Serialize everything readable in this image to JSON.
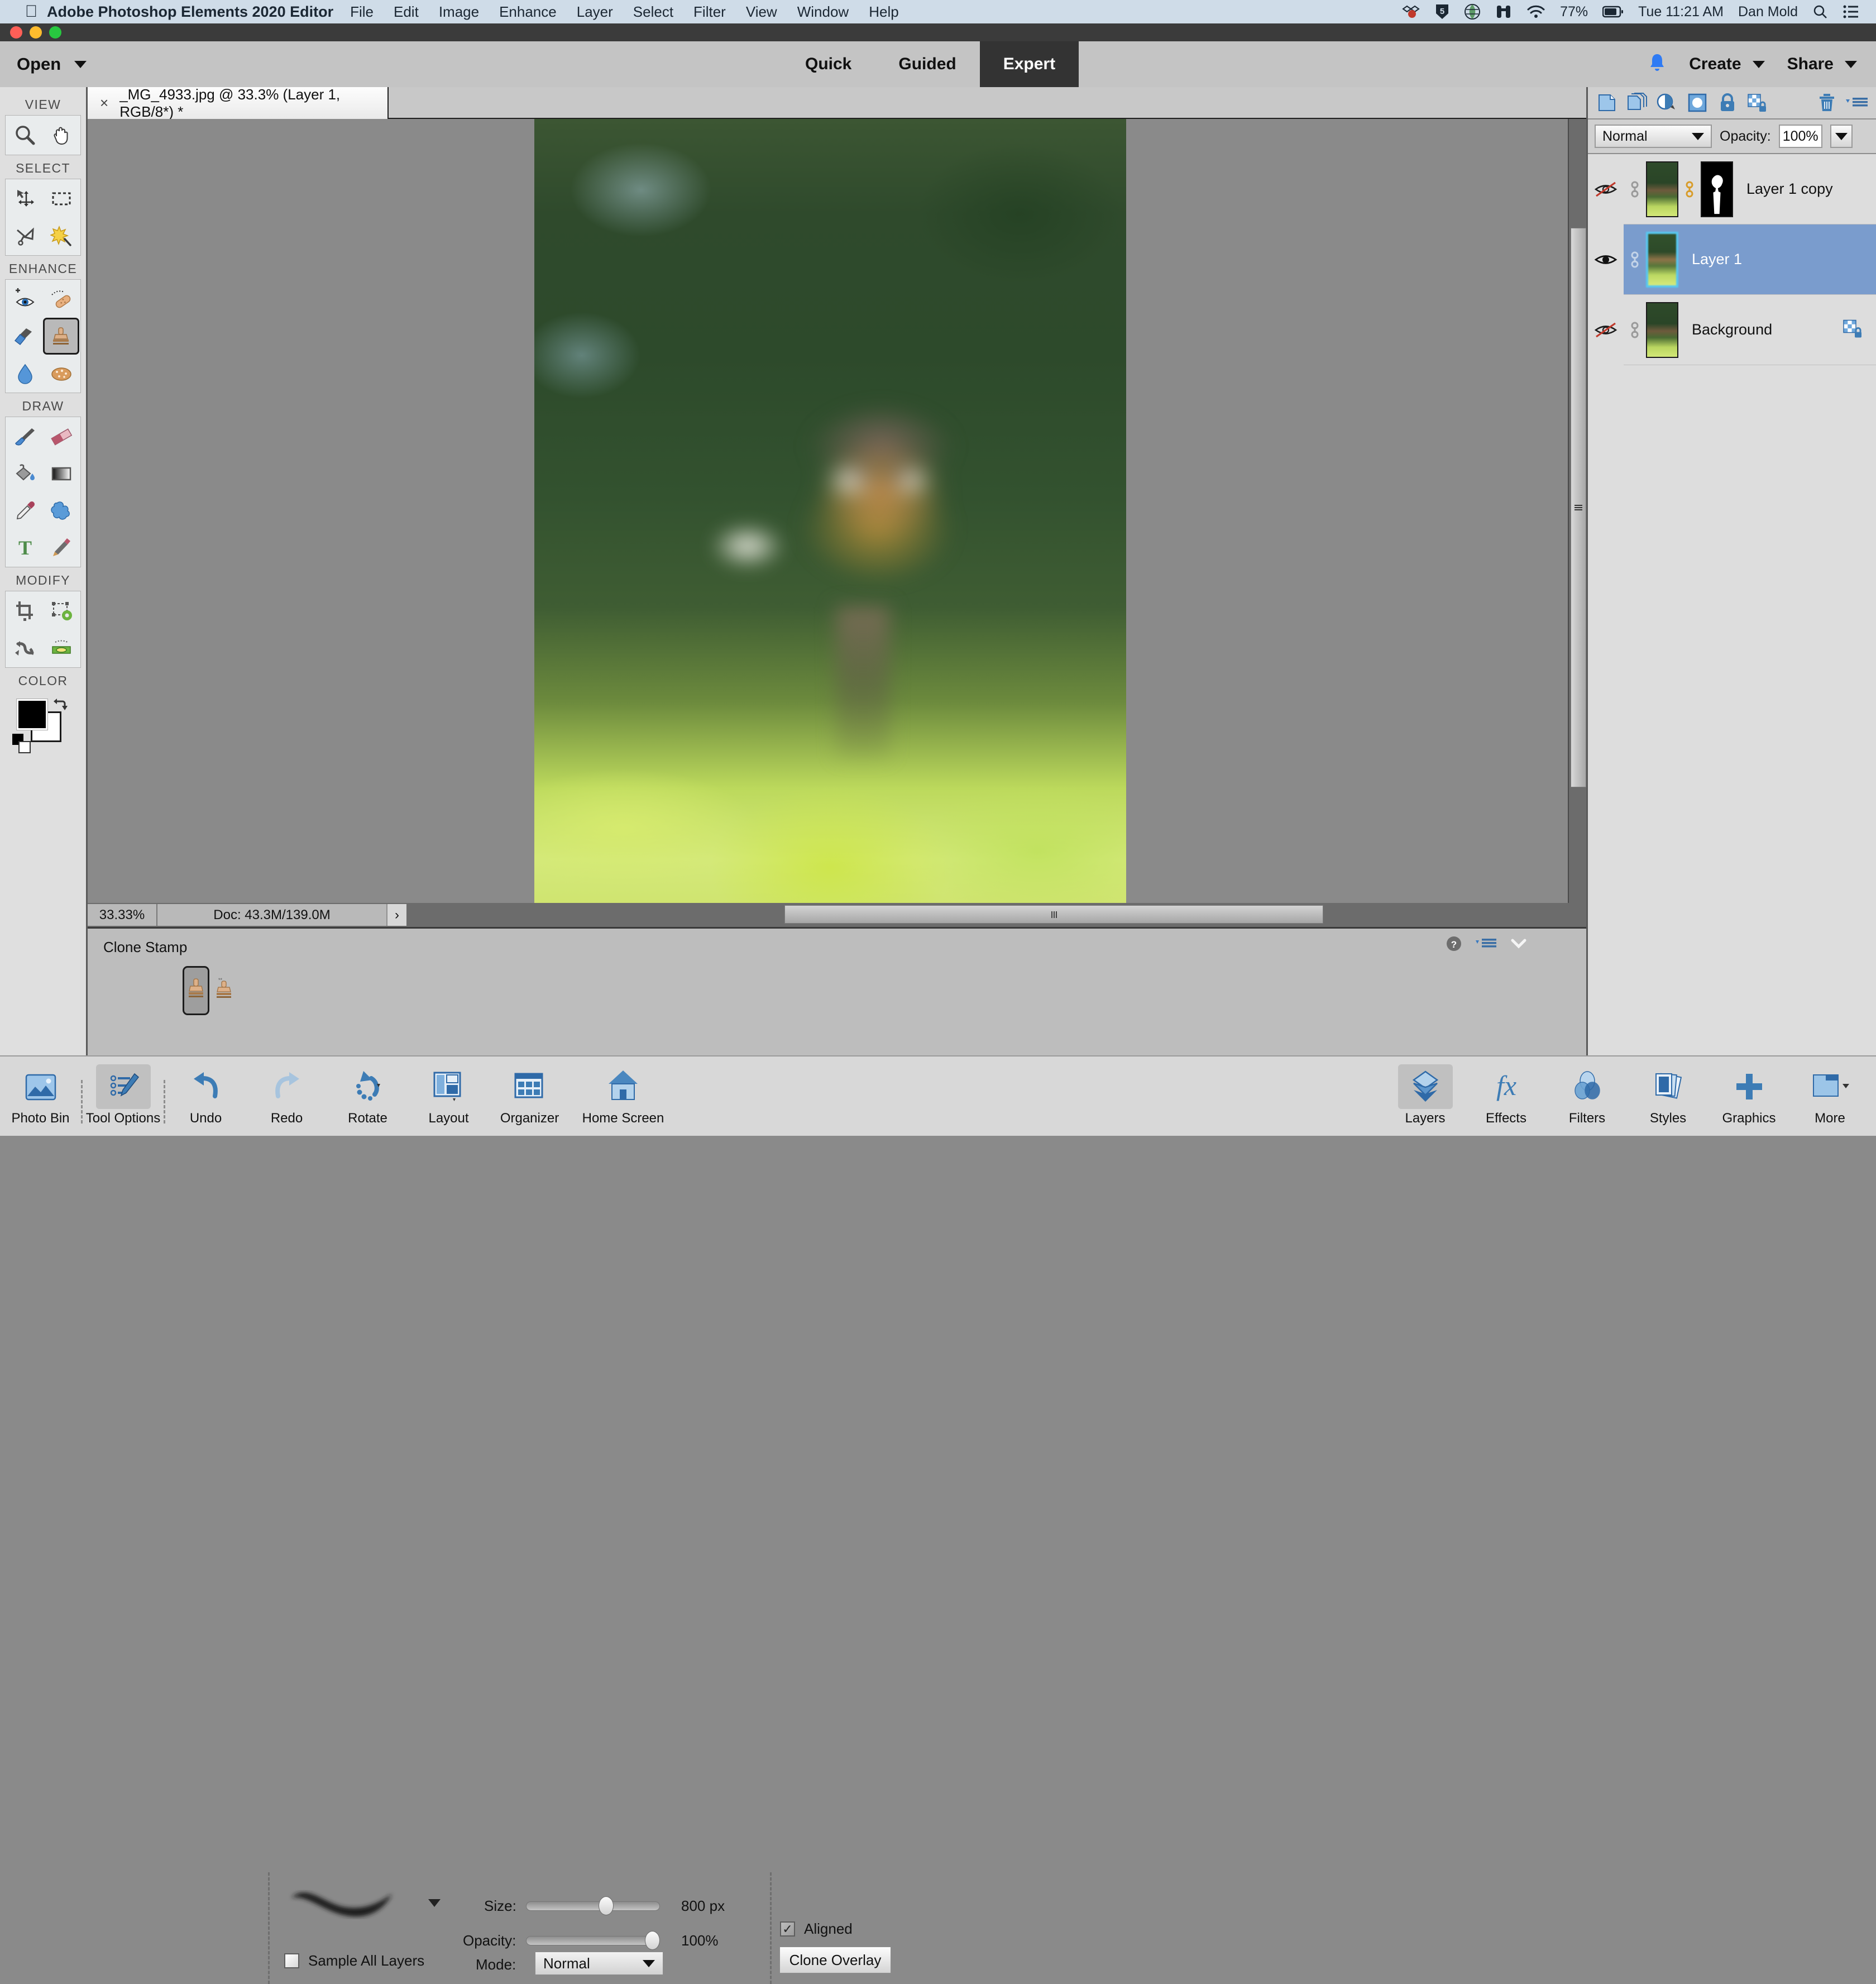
{
  "macbar": {
    "apple_icon": "apple-logo-icon",
    "app_title": "Adobe Photoshop Elements 2020 Editor",
    "menus": [
      "File",
      "Edit",
      "Image",
      "Enhance",
      "Layer",
      "Select",
      "Filter",
      "View",
      "Window",
      "Help"
    ],
    "status_icons": [
      "dropbox-icon",
      "shield-5-icon",
      "globe-icon",
      "binoculars-icon",
      "wifi-icon"
    ],
    "battery_percent": "77%",
    "clock": "Tue 11:21 AM",
    "user": "Dan Mold",
    "search_icon": "spotlight-search-icon",
    "control_center_icon": "control-center-icon"
  },
  "window": {
    "traffic_lights": [
      "close-button",
      "minimize-button",
      "zoom-button"
    ]
  },
  "topbar": {
    "open_label": "Open",
    "modes": [
      {
        "label": "Quick",
        "active": false
      },
      {
        "label": "Guided",
        "active": false
      },
      {
        "label": "Expert",
        "active": true
      }
    ],
    "bell_icon": "notification-bell-icon",
    "create_label": "Create",
    "share_label": "Share"
  },
  "toolbar": {
    "sections": [
      {
        "label": "VIEW",
        "tools": [
          "zoom-tool",
          "hand-tool"
        ]
      },
      {
        "label": "SELECT",
        "tools": [
          "move-tool",
          "rectangular-marquee-tool",
          "lasso-tool",
          "quick-selection-tool"
        ]
      },
      {
        "label": "ENHANCE",
        "tools": [
          "red-eye-removal-tool",
          "spot-healing-brush-tool",
          "smart-brush-tool",
          "clone-stamp-tool",
          "blur-tool",
          "sponge-tool"
        ]
      },
      {
        "label": "DRAW",
        "tools": [
          "brush-tool",
          "eraser-tool",
          "paint-bucket-tool",
          "gradient-tool",
          "eyedropper-tool",
          "custom-shape-tool",
          "type-tool",
          "pencil-tool"
        ]
      },
      {
        "label": "MODIFY",
        "tools": [
          "crop-tool",
          "recompose-tool",
          "content-aware-move-tool",
          "straighten-tool"
        ]
      },
      {
        "label": "COLOR",
        "tools": [
          "foreground-color-swatch",
          "background-color-swatch",
          "swap-colors-icon",
          "default-colors-icon"
        ]
      }
    ],
    "selected_tool": "clone-stamp-tool",
    "foreground_color": "#000000",
    "background_color": "#ffffff"
  },
  "document_tab": {
    "close_icon": "×",
    "title": "_MG_4933.jpg @ 33.3% (Layer 1, RGB/8*) *"
  },
  "statusbar": {
    "zoom": "33.33%",
    "doc_info": "Doc: 43.3M/139.0M",
    "expand_icon": "›"
  },
  "tool_options": {
    "title": "Clone Stamp",
    "presets": [
      {
        "name": "clone-stamp-preset",
        "selected": true
      },
      {
        "name": "pattern-stamp-preset",
        "selected": false
      }
    ],
    "brush_preset_icon": "soft-round-brush-thumbnail",
    "size_label": "Size:",
    "size_value": "800 px",
    "size_percent": 57,
    "opacity_label": "Opacity:",
    "opacity_value": "100%",
    "opacity_percent": 100,
    "sample_all_layers_label": "Sample All Layers",
    "sample_all_layers_checked": false,
    "mode_label": "Mode:",
    "mode_value": "Normal",
    "aligned_label": "Aligned",
    "aligned_checked": true,
    "clone_overlay_label": "Clone Overlay",
    "help_icon": "help-question-icon",
    "menu_icon": "panel-menu-icon",
    "collapse_icon": "chevron-down-icon"
  },
  "layers_panel": {
    "toolbar_icons": [
      "new-layer-icon",
      "duplicate-layer-icon",
      "adjustment-layer-icon",
      "layer-mask-icon",
      "lock-all-icon",
      "lock-transparency-icon",
      "delete-layer-icon",
      "panel-menu-icon"
    ],
    "blend_mode": "Normal",
    "opacity_label": "Opacity:",
    "opacity_value": "100%",
    "layers": [
      {
        "name": "Layer 1 copy",
        "visible": false,
        "selected": false,
        "has_mask": true,
        "linked": true,
        "locked": false,
        "visibility_icon": "eye-hidden-icon",
        "link_icon": "link-icon"
      },
      {
        "name": "Layer 1",
        "visible": true,
        "selected": true,
        "has_mask": false,
        "linked": false,
        "locked": false,
        "visibility_icon": "eye-visible-icon",
        "link_icon": "link-icon"
      },
      {
        "name": "Background",
        "visible": false,
        "selected": false,
        "has_mask": false,
        "linked": false,
        "locked": true,
        "visibility_icon": "eye-hidden-icon",
        "link_icon": "link-icon",
        "lock_icon": "lock-transparency-icon"
      }
    ]
  },
  "taskbar": {
    "left_items": [
      {
        "label": "Photo Bin",
        "icon": "photo-bin-icon",
        "active": false
      },
      {
        "label": "Tool Options",
        "icon": "tool-options-icon",
        "active": true
      },
      {
        "label": "Undo",
        "icon": "undo-arrow-icon",
        "active": false
      },
      {
        "label": "Redo",
        "icon": "redo-arrow-icon",
        "active": false
      },
      {
        "label": "Rotate",
        "icon": "rotate-icon",
        "active": false
      },
      {
        "label": "Layout",
        "icon": "layout-icon",
        "active": false
      },
      {
        "label": "Organizer",
        "icon": "organizer-icon",
        "active": false
      },
      {
        "label": "Home Screen",
        "icon": "home-screen-icon",
        "active": false
      }
    ],
    "right_items": [
      {
        "label": "Layers",
        "icon": "layers-stack-icon",
        "active": true
      },
      {
        "label": "Effects",
        "icon": "fx-icon",
        "active": false
      },
      {
        "label": "Filters",
        "icon": "filters-venn-icon",
        "active": false
      },
      {
        "label": "Styles",
        "icon": "styles-cards-icon",
        "active": false
      },
      {
        "label": "Graphics",
        "icon": "plus-icon",
        "active": false
      },
      {
        "label": "More",
        "icon": "more-panel-icon",
        "active": false
      }
    ]
  },
  "canvas": {
    "image_description": "blurred photograph of a small owl perched on a wooden post with green foliage background",
    "zoom_percent": "33.33%"
  }
}
